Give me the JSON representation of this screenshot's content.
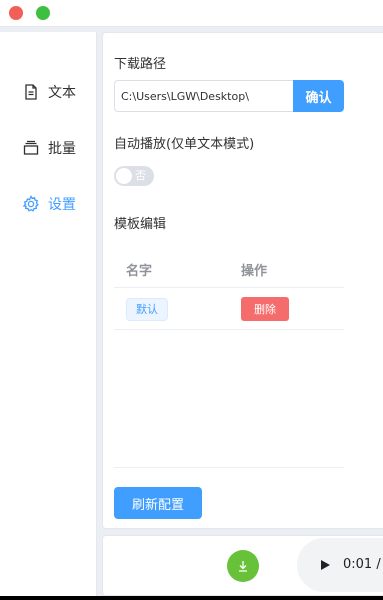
{
  "window": {
    "controls": [
      "close",
      "maximize"
    ]
  },
  "sidebar": {
    "items": [
      {
        "label": "文本",
        "icon": "document-icon",
        "active": false
      },
      {
        "label": "批量",
        "icon": "stack-icon",
        "active": false
      },
      {
        "label": "设置",
        "icon": "gear-icon",
        "active": true
      }
    ]
  },
  "settings": {
    "download_path_label": "下载路径",
    "download_path_value": "C:\\Users\\LGW\\Desktop\\",
    "confirm_label": "确认",
    "autoplay_label": "自动播放(仅单文本模式)",
    "autoplay_toggle_text": "否",
    "autoplay_on": false,
    "template_label": "模板编辑",
    "table": {
      "headers": [
        "名字",
        "操作"
      ],
      "rows": [
        {
          "name": "默认",
          "action": "删除"
        }
      ]
    },
    "refresh_label": "刷新配置"
  },
  "player": {
    "time": "0:01 /"
  },
  "colors": {
    "accent": "#409eff",
    "danger": "#f56c6c",
    "success": "#67c23a"
  }
}
